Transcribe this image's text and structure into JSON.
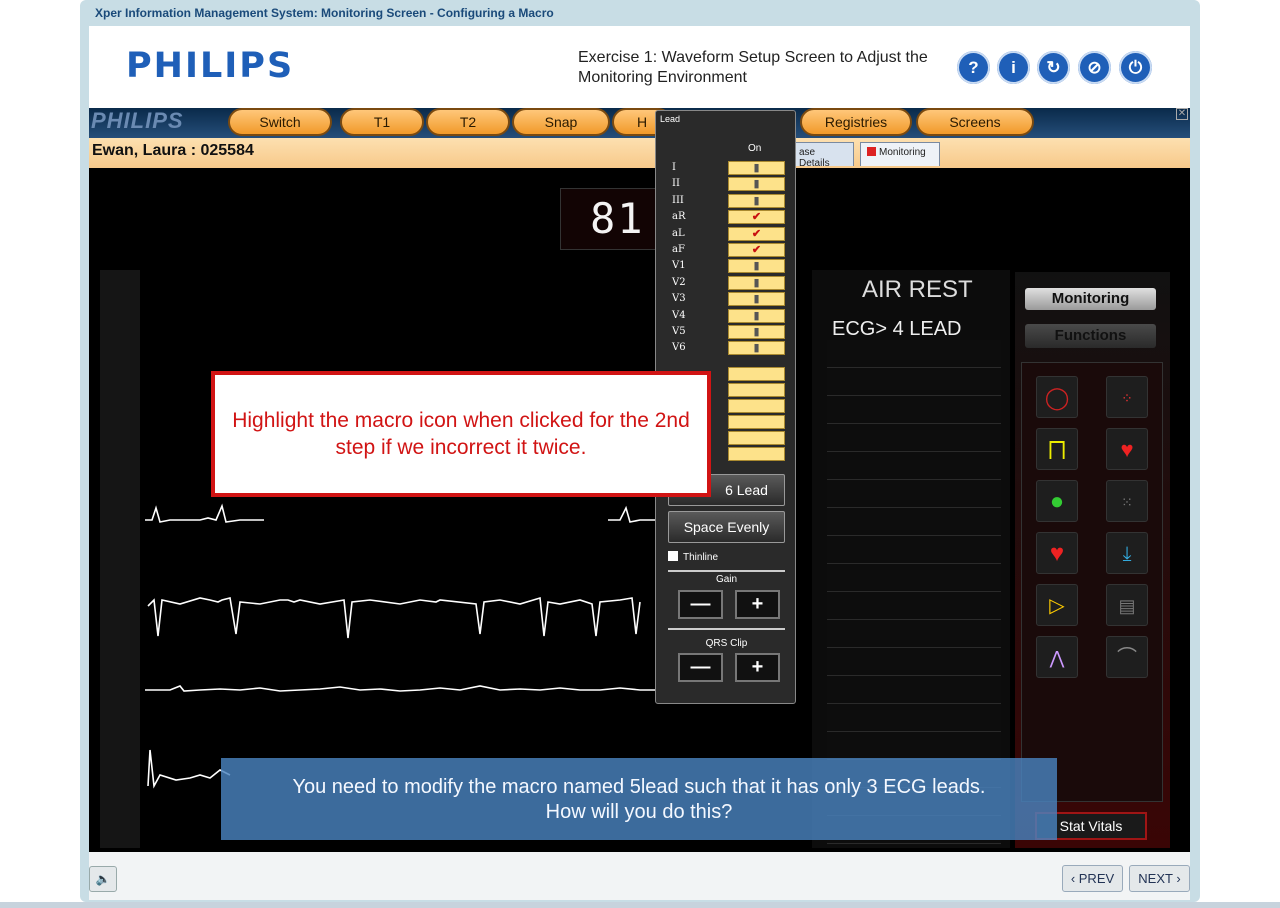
{
  "window": {
    "title": "Xper Information Management System: Monitoring Screen - Configuring a Macro"
  },
  "header": {
    "logo": "PHILIPS",
    "exercise": "Exercise 1: Waveform Setup Screen to Adjust the Monitoring Environment",
    "buttons": [
      {
        "icon": "help-icon",
        "glyph": "?"
      },
      {
        "icon": "info-icon",
        "glyph": "i"
      },
      {
        "icon": "refresh-icon",
        "glyph": "↻"
      },
      {
        "icon": "compass-icon",
        "glyph": "⊘"
      },
      {
        "icon": "power-icon",
        "glyph": "⏻"
      }
    ]
  },
  "app": {
    "logo": "PHILIPS",
    "menu": {
      "switch": "Switch",
      "t1": "T1",
      "t2": "T2",
      "snap": "Snap",
      "hidden": "H",
      "registries": "Registries",
      "screens": "Screens"
    },
    "patient": "Ewan, Laura   : 025584",
    "tabs": {
      "case_details": "ase Details",
      "monitoring": "Monitoring"
    },
    "heart_rate": "81",
    "air_rest": "AIR REST",
    "ecg_mode": "ECG>  4 LEAD",
    "function_tabs": {
      "monitoring": "Monitoring",
      "functions": "Functions"
    },
    "stat_vitals": "Stat Vitals"
  },
  "lead_panel": {
    "title": "Lead",
    "on_header": "On",
    "leads": [
      {
        "name": "I",
        "checked": false
      },
      {
        "name": "II",
        "checked": false
      },
      {
        "name": "III",
        "checked": false
      },
      {
        "name": "aR",
        "checked": true
      },
      {
        "name": "aL",
        "checked": true
      },
      {
        "name": "aF",
        "checked": true
      },
      {
        "name": "V1",
        "checked": false
      },
      {
        "name": "V2",
        "checked": false
      },
      {
        "name": "V3",
        "checked": false
      },
      {
        "name": "V4",
        "checked": false
      },
      {
        "name": "V5",
        "checked": false
      },
      {
        "name": "V6",
        "checked": false
      }
    ],
    "six_lead": "6 Lead",
    "space_evenly": "Space Evenly",
    "thinline": "Thinline",
    "gain": "Gain",
    "qrs_clip": "QRS Clip",
    "minus": "—",
    "plus": "+"
  },
  "callout": {
    "text": "Highlight the macro icon when clicked for the 2nd step if we incorrect it twice."
  },
  "caption": {
    "line1": "You need to modify the macro named 5lead such that it has only 3 ECG leads.",
    "line2": "How will you do this?"
  },
  "footer": {
    "prev": "PREV",
    "next": "NEXT",
    "speaker_glyph": "🔈"
  },
  "colors": {
    "brand": "#1f5fb8",
    "menu_tab": "#f19a2a",
    "callout_red": "#d11414",
    "caption_bg": "#4982be"
  }
}
